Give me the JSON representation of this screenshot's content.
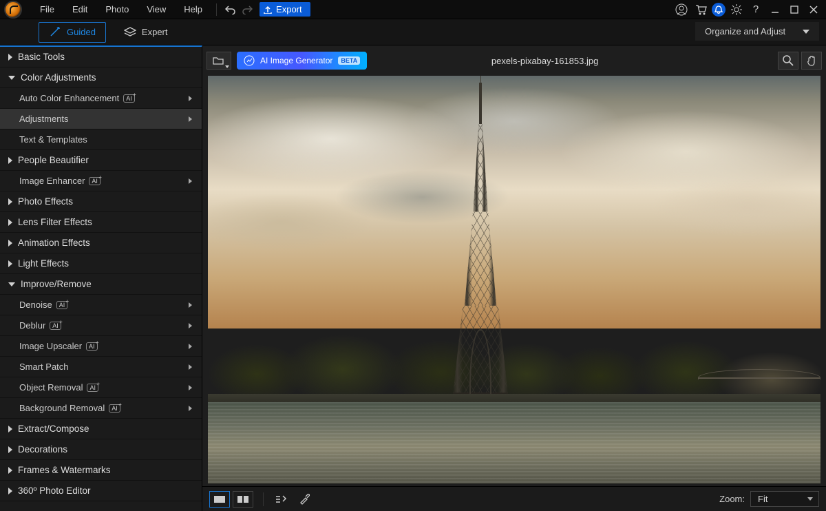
{
  "menu": {
    "file": "File",
    "edit": "Edit",
    "photo": "Photo",
    "view": "View",
    "help": "Help"
  },
  "export_label": "Export",
  "tabs": {
    "guided": "Guided",
    "expert": "Expert"
  },
  "organize_label": "Organize and Adjust",
  "ai_generator": {
    "label": "AI Image Generator",
    "badge": "BETA"
  },
  "filename": "pexels-pixabay-161853.jpg",
  "sidebar": {
    "basic_tools": "Basic Tools",
    "color_adjustments": "Color Adjustments",
    "auto_color": "Auto Color Enhancement",
    "adjustments": "Adjustments",
    "text_templates": "Text & Templates",
    "people_beautifier": "People Beautifier",
    "image_enhancer": "Image Enhancer",
    "photo_effects": "Photo Effects",
    "lens_filter": "Lens Filter Effects",
    "animation_effects": "Animation Effects",
    "light_effects": "Light Effects",
    "improve_remove": "Improve/Remove",
    "denoise": "Denoise",
    "deblur": "Deblur",
    "image_upscaler": "Image Upscaler",
    "smart_patch": "Smart Patch",
    "object_removal": "Object Removal",
    "background_removal": "Background Removal",
    "extract_compose": "Extract/Compose",
    "decorations": "Decorations",
    "frames_watermarks": "Frames & Watermarks",
    "photo_editor_360": "360º Photo Editor"
  },
  "zoom": {
    "label": "Zoom:",
    "value": "Fit"
  }
}
